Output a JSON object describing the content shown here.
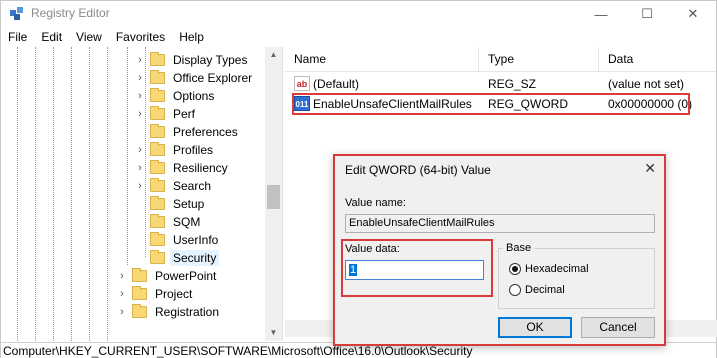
{
  "window": {
    "title": "Registry Editor",
    "minimize_glyph": "—",
    "maximize_glyph": "☐",
    "close_glyph": "✕"
  },
  "menu": [
    "File",
    "Edit",
    "View",
    "Favorites",
    "Help"
  ],
  "tree": {
    "subkeys": [
      "Display Types",
      "Office Explorer",
      "Options",
      "Perf",
      "Preferences",
      "Profiles",
      "Resiliency",
      "Search",
      "Setup",
      "SQM",
      "UserInfo",
      "Security"
    ],
    "selected": "Security",
    "siblings": [
      "PowerPoint",
      "Project",
      "Registration"
    ],
    "chevron_glyph": "›"
  },
  "list": {
    "columns": [
      "Name",
      "Type",
      "Data"
    ],
    "rows": [
      {
        "icon": "string-value-icon",
        "icon_text": "ab",
        "name": "(Default)",
        "type": "REG_SZ",
        "data": "(value not set)"
      },
      {
        "icon": "binary-value-icon",
        "icon_text": "011",
        "name": "EnableUnsafeClientMailRules",
        "type": "REG_QWORD",
        "data": "0x00000000 (0)"
      }
    ]
  },
  "statusbar": {
    "path": "Computer\\HKEY_CURRENT_USER\\SOFTWARE\\Microsoft\\Office\\16.0\\Outlook\\Security"
  },
  "dialog": {
    "title": "Edit QWORD (64-bit) Value",
    "close_glyph": "✕",
    "value_name_label": "Value name:",
    "value_name": "EnableUnsafeClientMailRules",
    "value_data_label": "Value data:",
    "value_data": "1",
    "base_label": "Base",
    "radio_hex": "Hexadecimal",
    "radio_dec": "Decimal",
    "base_selected": "Hexadecimal",
    "ok": "OK",
    "cancel": "Cancel"
  },
  "colors": {
    "highlight_border": "#d93b3b",
    "selection_blue": "#0078d7",
    "folder_yellow": "#f8d775"
  }
}
